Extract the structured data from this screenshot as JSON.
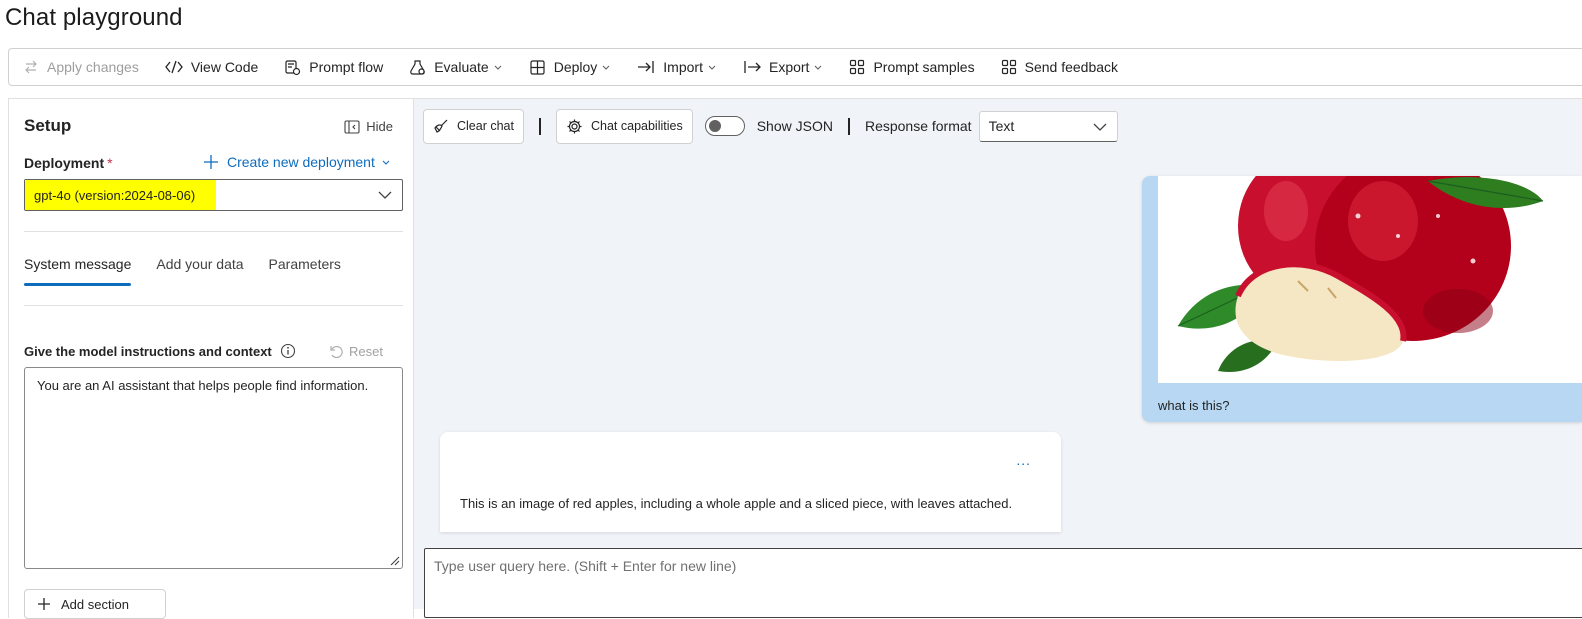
{
  "page": {
    "title": "Chat playground"
  },
  "toolbar": {
    "apply_changes": "Apply changes",
    "view_code": "View Code",
    "prompt_flow": "Prompt flow",
    "evaluate": "Evaluate",
    "deploy": "Deploy",
    "import": "Import",
    "export": "Export",
    "prompt_samples": "Prompt samples",
    "send_feedback": "Send feedback"
  },
  "setup": {
    "title": "Setup",
    "hide": "Hide",
    "deployment_label": "Deployment",
    "required_mark": "*",
    "create_deployment": "Create new deployment",
    "deployment_value": "gpt-4o (version:2024-08-06)",
    "tabs": [
      {
        "label": "System message",
        "active": true
      },
      {
        "label": "Add your data",
        "active": false
      },
      {
        "label": "Parameters",
        "active": false
      }
    ],
    "instructions_label": "Give the model instructions and context",
    "reset": "Reset",
    "system_message": "You are an AI assistant that helps people find information.",
    "add_section": "Add section"
  },
  "chat": {
    "clear_chat": "Clear chat",
    "chat_capabilities": "Chat capabilities",
    "show_json": "Show JSON",
    "show_json_on": false,
    "response_format_label": "Response format",
    "response_format_value": "Text",
    "user_message": "what is this?",
    "assistant_message": "This is an image of red apples, including a whole apple and a sliced piece, with leaves attached.",
    "more_actions": "...",
    "input_placeholder": "Type user query here. (Shift + Enter for new line)"
  },
  "colors": {
    "accent": "#0f6cbd",
    "highlight": "#ffff00",
    "user_bubble": "#b7d7f3",
    "chat_background": "#f0f4f9"
  }
}
